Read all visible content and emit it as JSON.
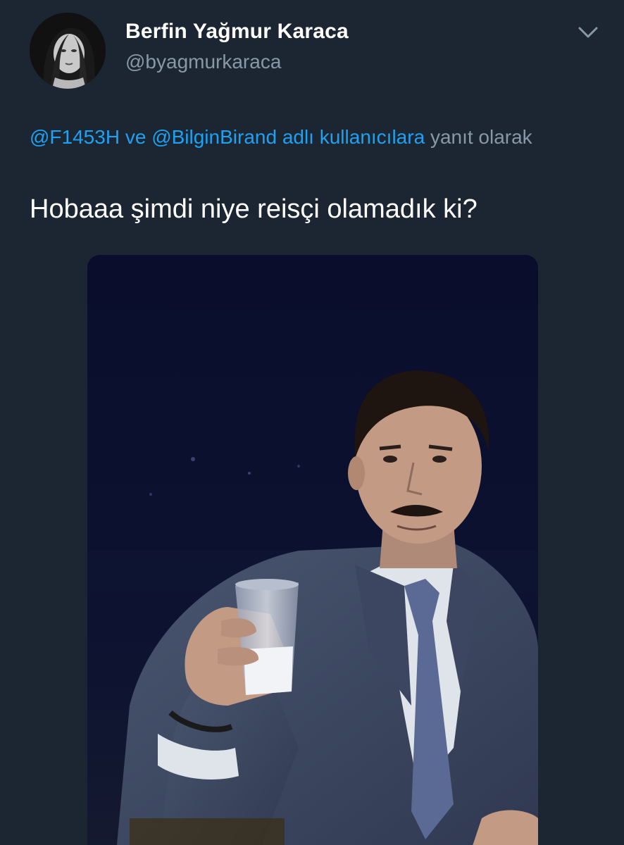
{
  "tweet": {
    "author": {
      "display_name": "Berfin Yağmur Karaca",
      "handle": "@byagmurkaraca",
      "avatar_icon": "profile-photo"
    },
    "menu_icon": "chevron-down-icon",
    "reply_context": {
      "mention_1": "@F1453H",
      "joiner": "ve",
      "mention_2": "@BilginBirand",
      "suffix_link": "adlı kullanıcılara",
      "suffix": "yanıt olarak"
    },
    "text": "Hobaaa şimdi niye reisçi olamadık ki?",
    "media": {
      "type": "photo"
    }
  },
  "colors": {
    "background": "#1c2632",
    "link": "#1da1f2",
    "secondary_text": "#8899a6",
    "primary_text": "#ffffff"
  }
}
